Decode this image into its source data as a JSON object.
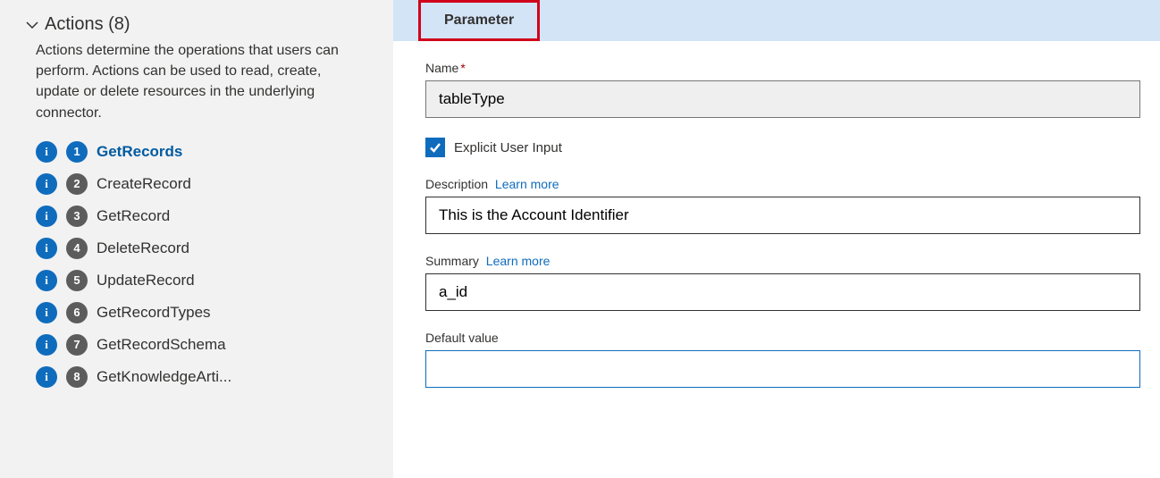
{
  "sidebar": {
    "title": "Actions (8)",
    "description": "Actions determine the operations that users can perform. Actions can be used to read, create, update or delete resources in the underlying connector.",
    "items": [
      {
        "num": "1",
        "label": "GetRecords",
        "selected": true
      },
      {
        "num": "2",
        "label": "CreateRecord",
        "selected": false
      },
      {
        "num": "3",
        "label": "GetRecord",
        "selected": false
      },
      {
        "num": "4",
        "label": "DeleteRecord",
        "selected": false
      },
      {
        "num": "5",
        "label": "UpdateRecord",
        "selected": false
      },
      {
        "num": "6",
        "label": "GetRecordTypes",
        "selected": false
      },
      {
        "num": "7",
        "label": "GetRecordSchema",
        "selected": false
      },
      {
        "num": "8",
        "label": "GetKnowledgeArti...",
        "selected": false
      }
    ]
  },
  "tab": {
    "label": "Parameter"
  },
  "form": {
    "name_label": "Name",
    "name_value": "tableType",
    "explicit_label": "Explicit User Input",
    "explicit_checked": true,
    "description_label": "Description",
    "description_value": "This is the Account Identifier",
    "summary_label": "Summary",
    "summary_value": "a_id",
    "default_label": "Default value",
    "default_value": "",
    "learn_more": "Learn more"
  }
}
